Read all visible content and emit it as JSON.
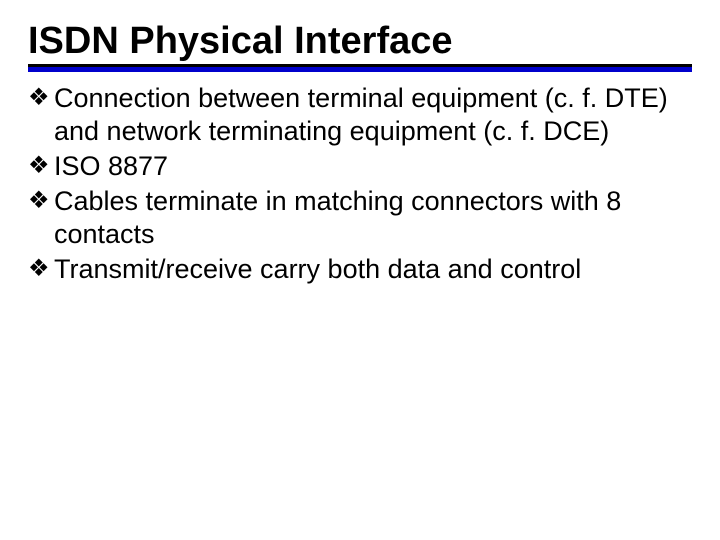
{
  "title": "ISDN Physical Interface",
  "bullets": [
    "Connection between terminal equipment (c. f. DTE) and network terminating equipment (c. f. DCE)",
    "ISO 8877",
    "Cables terminate in matching connectors with 8 contacts",
    "Transmit/receive carry both data and control"
  ],
  "bullet_marker": "❖"
}
